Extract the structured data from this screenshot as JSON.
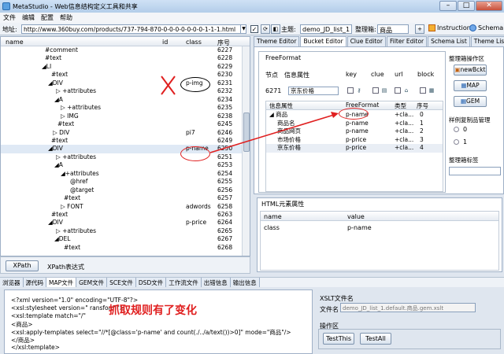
{
  "window": {
    "title": "MetaStudio - Web信息结构定义工具和共享"
  },
  "menu": [
    "文件",
    "编辑",
    "配置",
    "帮助"
  ],
  "address": {
    "label": "地址:",
    "url": "http://www.360buy.com/products/737-794-870-0-0-0-0-0-0-0-1-1-1.html"
  },
  "topic": {
    "label": "主题:",
    "value": "demo_JD_list_1"
  },
  "organizer": {
    "label": "整理箱:",
    "value": "商品"
  },
  "toolbar": {
    "instruction": "Instruction",
    "schema": "Schema"
  },
  "tree": {
    "columns": {
      "name": "name",
      "id": "id",
      "class": "class",
      "seq": "序号"
    },
    "rows": [
      {
        "indent": 56,
        "name": "#comment",
        "id": "",
        "class": "",
        "seq": "6227"
      },
      {
        "indent": 56,
        "name": "#text",
        "id": "",
        "class": "",
        "seq": "6228"
      },
      {
        "indent": 52,
        "name": "◢LI",
        "id": "",
        "class": "",
        "seq": "6229"
      },
      {
        "indent": 64,
        "name": "#text",
        "id": "",
        "class": "",
        "seq": "6230"
      },
      {
        "indent": 60,
        "name": "◢DIV",
        "id": "",
        "class": "p-img",
        "seq": "6231"
      },
      {
        "indent": 70,
        "name": "▷ +attributes",
        "id": "",
        "class": "",
        "seq": "6232"
      },
      {
        "indent": 68,
        "name": "◢A",
        "id": "",
        "class": "",
        "seq": "6234"
      },
      {
        "indent": 76,
        "name": "▷ +attributes",
        "id": "",
        "class": "",
        "seq": "6235"
      },
      {
        "indent": 76,
        "name": "▷ IMG",
        "id": "",
        "class": "",
        "seq": "6238"
      },
      {
        "indent": 72,
        "name": "#text",
        "id": "",
        "class": "",
        "seq": "6245"
      },
      {
        "indent": 66,
        "name": "▷ DIV",
        "id": "",
        "class": "pi7",
        "seq": "6246"
      },
      {
        "indent": 64,
        "name": "#text",
        "id": "",
        "class": "",
        "seq": "6249"
      },
      {
        "indent": 60,
        "name": "◢DIV",
        "id": "",
        "class": "p-name",
        "seq": "6250",
        "selected": true
      },
      {
        "indent": 70,
        "name": "▷ +attributes",
        "id": "",
        "class": "",
        "seq": "6251"
      },
      {
        "indent": 68,
        "name": "◢A",
        "id": "",
        "class": "",
        "seq": "6253"
      },
      {
        "indent": 76,
        "name": "◢+attributes",
        "id": "",
        "class": "",
        "seq": "6254"
      },
      {
        "indent": 88,
        "name": "@href",
        "id": "",
        "class": "",
        "seq": "6255"
      },
      {
        "indent": 88,
        "name": "@target",
        "id": "",
        "class": "",
        "seq": "6256"
      },
      {
        "indent": 80,
        "name": "#text",
        "id": "",
        "class": "",
        "seq": "6257"
      },
      {
        "indent": 76,
        "name": "▷ FONT",
        "id": "",
        "class": "adwords",
        "seq": "6258"
      },
      {
        "indent": 64,
        "name": "#text",
        "id": "",
        "class": "",
        "seq": "6263"
      },
      {
        "indent": 60,
        "name": "◢DIV",
        "id": "",
        "class": "p-price",
        "seq": "6264"
      },
      {
        "indent": 70,
        "name": "▷ +attributes",
        "id": "",
        "class": "",
        "seq": "6265"
      },
      {
        "indent": 68,
        "name": "◢DEL",
        "id": "",
        "class": "",
        "seq": "6267"
      },
      {
        "indent": 80,
        "name": "#text",
        "id": "",
        "class": "",
        "seq": "6268"
      }
    ]
  },
  "xpath": {
    "button": "XPath",
    "label": "XPath表达式"
  },
  "right_tabs": [
    "Theme Editor",
    "Bucket Editor",
    "Clue Editor",
    "Filter Editor",
    "Schema List",
    "Theme List"
  ],
  "right_active_tab": "Bucket Editor",
  "freeformat": {
    "legend": "FreeFormat",
    "head": {
      "node": "节点",
      "info": "信息属性",
      "key": "key",
      "clue": "clue",
      "url": "url",
      "block": "block"
    },
    "node_id": "6271",
    "input_value": "京东价格",
    "table_headers": {
      "attr": "信息属性",
      "ff": "FreeFormat",
      "type": "类型",
      "seq": "序号"
    },
    "rows": [
      {
        "attr": "◢ 商品",
        "ff": "p-name",
        "type": "+cla...",
        "seq": "0"
      },
      {
        "attr": "商品名",
        "ff": "p-name",
        "type": "+cla...",
        "seq": "1"
      },
      {
        "attr": "商品网页",
        "ff": "p-name",
        "type": "+cla...",
        "seq": "2"
      },
      {
        "attr": "市场价格",
        "ff": "p-price",
        "type": "+cla...",
        "seq": "3"
      },
      {
        "attr": "京东价格",
        "ff": "p-price",
        "type": "+cla...",
        "seq": "4"
      }
    ]
  },
  "organizer_panel": {
    "title": "整理箱操作区",
    "buttons": [
      "newBckt",
      "MAP",
      "GEM"
    ],
    "sample_title": "样例复制品管理",
    "radios": [
      "0",
      "1"
    ],
    "tag_title": "整理箱标签"
  },
  "html_elements": {
    "title": "HTML元素属性",
    "headers": {
      "name": "name",
      "value": "value"
    },
    "rows": [
      {
        "name": "class",
        "value": "p-name"
      }
    ]
  },
  "bottom_tabs": [
    "浏览器",
    "源代码",
    "MAP文件",
    "GEM文件",
    "SCE文件",
    "DSD文件",
    "工作流文件",
    "出错信息",
    "输出信息"
  ],
  "bottom_active_tab": "MAP文件",
  "code_lines": [
    "<?xml version=\"1.0\" encoding=\"UTF-8\"?>",
    "<xsl:stylesheet version=\"          ransform\">",
    "<xsl:template match=\"/\"",
    "<商品>",
    "<xsl:apply-templates select=\"//*[@class='p-name' and count(./../a/text())>0]\" mode=\"商品\"/>",
    "</商品>",
    "</xsl:template>"
  ],
  "annotation_text": "抓取规则有了变化",
  "xslt": {
    "title": "XSLT文件名",
    "file_label": "文件名",
    "file_value": "demo_JD_list_1.default.商品.gem.xslt",
    "op_title": "操作区",
    "test_this": "TestThis",
    "test_all": "TestAll"
  }
}
